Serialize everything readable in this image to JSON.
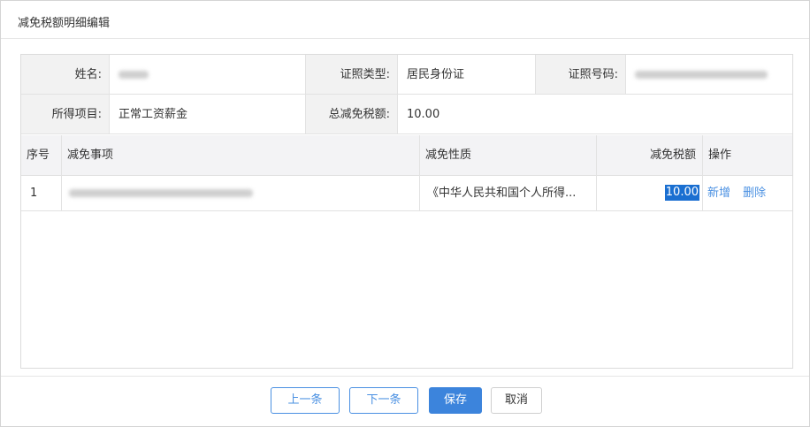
{
  "dialog": {
    "title": "减免税额明细编辑"
  },
  "info": {
    "name_label": "姓名:",
    "id_type_label": "证照类型:",
    "id_type_value": "居民身份证",
    "id_no_label": "证照号码:",
    "income_item_label": "所得项目:",
    "income_item_value": "正常工资薪金",
    "total_label": "总减免税额:",
    "total_value": "10.00"
  },
  "table": {
    "columns": [
      "序号",
      "减免事项",
      "减免性质",
      "减免税额",
      "操作"
    ],
    "rows": [
      {
        "index": "1",
        "nature": "《中华人民共和国个人所得...",
        "amount": "10.00",
        "op_add": "新增",
        "op_delete": "删除"
      }
    ]
  },
  "buttons": {
    "prev": "上一条",
    "next": "下一条",
    "save": "保存",
    "cancel": "取消"
  },
  "colors": {
    "accent": "#3c84dc",
    "link": "#4a90e2",
    "selection": "#1a6fd1"
  }
}
